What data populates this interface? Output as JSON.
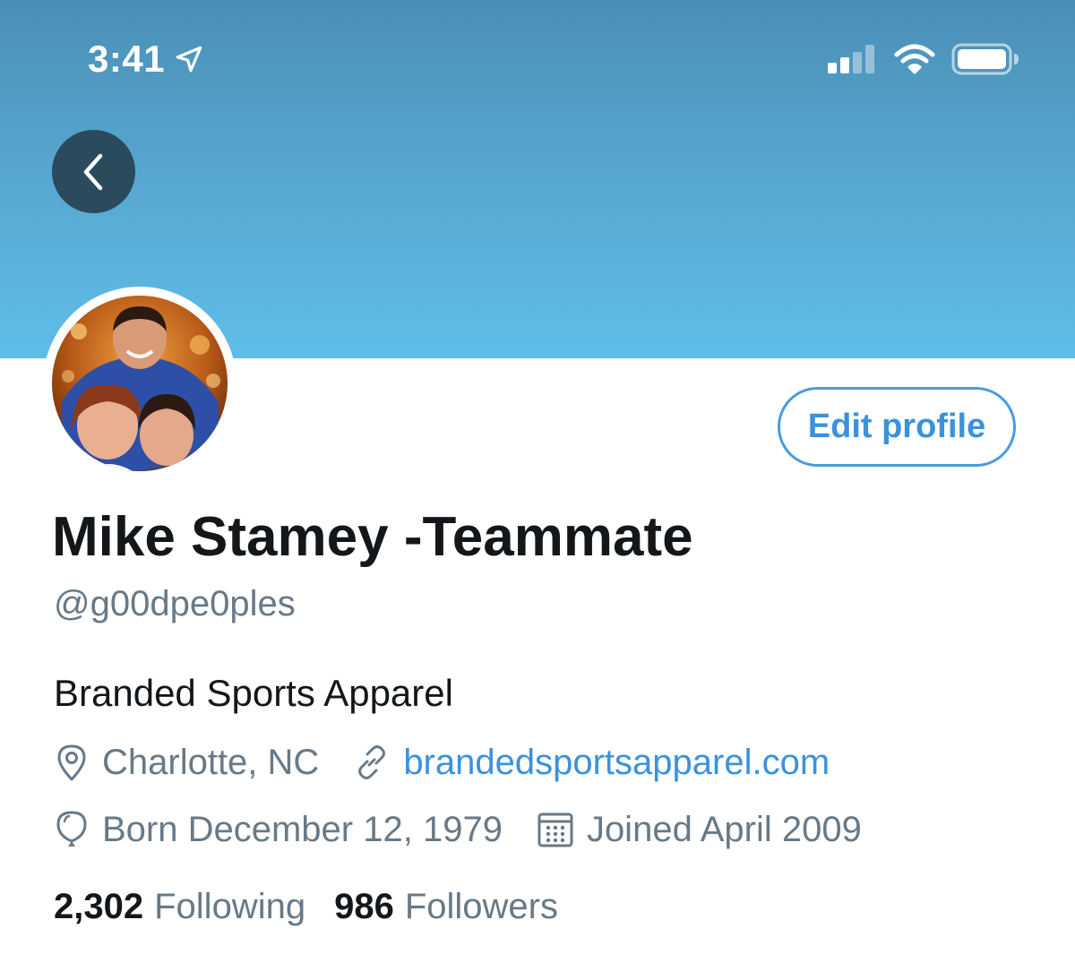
{
  "status_bar": {
    "time": "3:41",
    "location_icon": "location-arrow-icon",
    "signal_icon": "cellular-signal-icon",
    "wifi_icon": "wifi-icon",
    "battery_icon": "battery-icon"
  },
  "header": {
    "back_icon": "chevron-left-icon"
  },
  "profile": {
    "edit_button_label": "Edit profile",
    "display_name": "Mike Stamey -Teammate",
    "handle": "@g00dpe0ples",
    "bio": "Branded Sports Apparel",
    "location": "Charlotte, NC",
    "website": "brandedsportsapparel.com",
    "birthday": "Born December 12, 1979",
    "joined": "Joined April 2009",
    "following_count": "2,302",
    "following_label": "Following",
    "followers_count": "986",
    "followers_label": "Followers"
  },
  "colors": {
    "banner_top": "#4a8fb5",
    "banner_bottom": "#5fbde8",
    "accent": "#3a92dd",
    "secondary_text": "#687987",
    "primary_text": "#14171a",
    "back_button_bg": "#2a4b5c"
  }
}
